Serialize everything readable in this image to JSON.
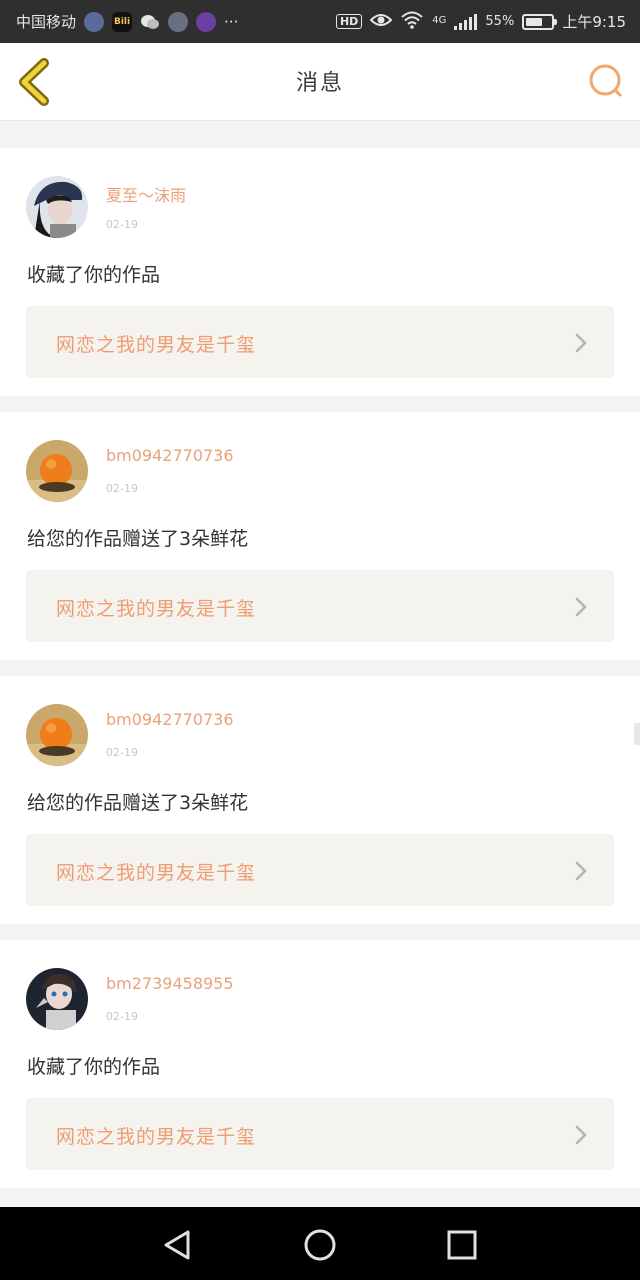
{
  "status_bar": {
    "carrier": "中国移动",
    "network": "4G",
    "signal_strength": "55%",
    "time": "上午9:15",
    "hd": "HD",
    "more": "···",
    "app_icons": [
      "settings-icon",
      "bilibili-icon",
      "wechat-icon",
      "qq-icon",
      "app-icon"
    ],
    "bilibili_label": "Bili"
  },
  "header": {
    "title": "消息",
    "accent_color": "#f2a56d"
  },
  "notifications": [
    {
      "username": "夏至～沫雨",
      "date": "02-19",
      "action": "收藏了你的作品",
      "work_title": "网恋之我的男友是千玺",
      "avatar": "girl-with-cap-avatar"
    },
    {
      "username": "bm0942770736",
      "date": "02-19",
      "action": "给您的作品赠送了3朵鲜花",
      "work_title": "网恋之我的男友是千玺",
      "avatar": "orange-ball-avatar"
    },
    {
      "username": "bm0942770736",
      "date": "02-19",
      "action": "给您的作品赠送了3朵鲜花",
      "work_title": "网恋之我的男友是千玺",
      "avatar": "orange-ball-avatar"
    },
    {
      "username": "bm2739458955",
      "date": "02-19",
      "action": "收藏了你的作品",
      "work_title": "网恋之我的男友是千玺",
      "avatar": "anime-girl-avatar"
    }
  ],
  "nav_bar": {
    "buttons": [
      "back-triangle-icon",
      "home-circle-icon",
      "recents-square-icon"
    ]
  }
}
